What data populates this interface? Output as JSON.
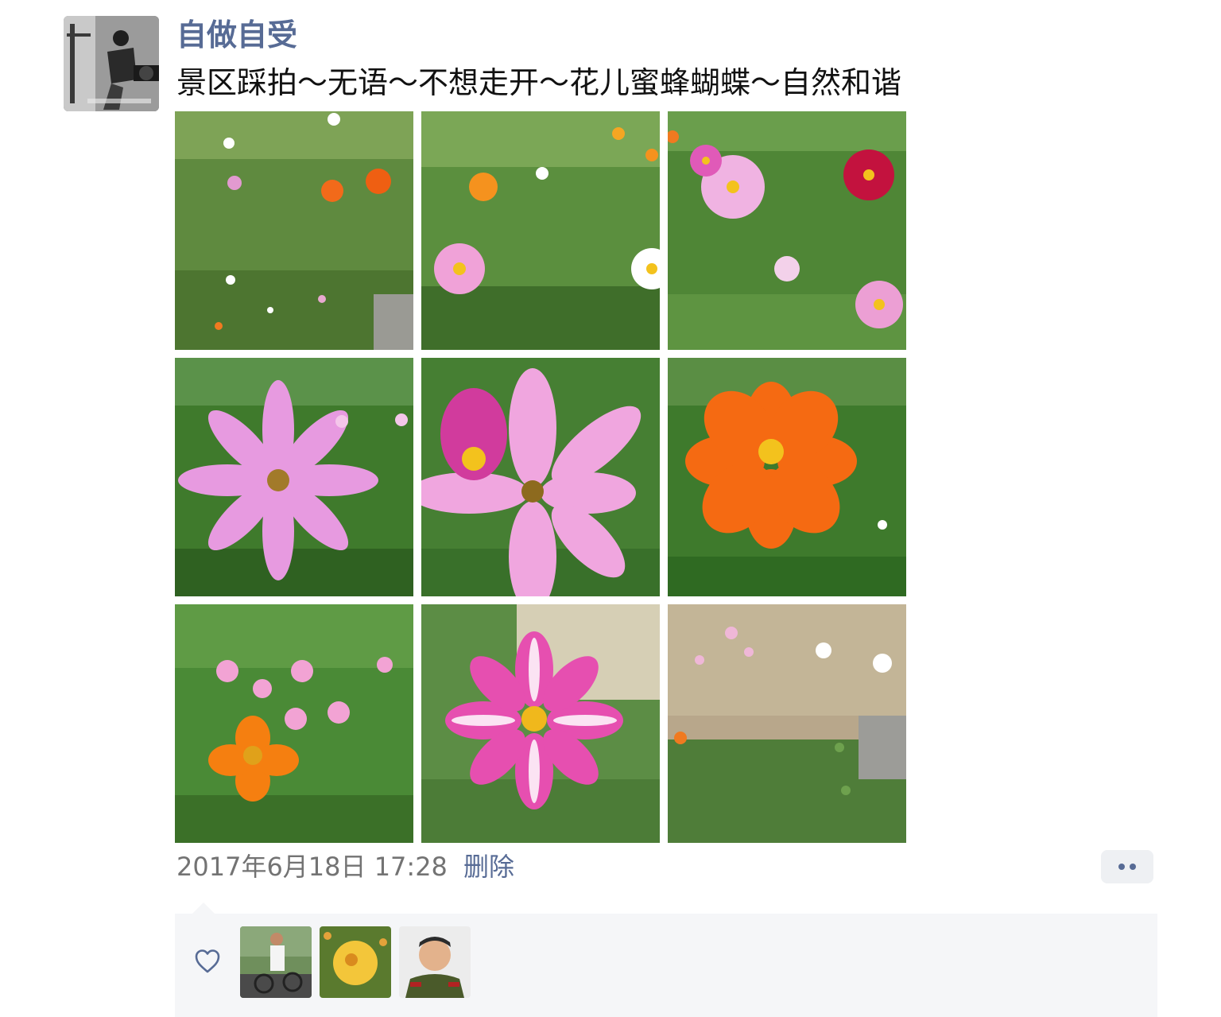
{
  "post": {
    "author_name": "自做自受",
    "text": "景区踩拍～无语～不想走开～花儿蜜蜂蝴蝶～自然和谐",
    "timestamp": "2017年6月18日 17:28",
    "delete_label": "删除",
    "photo_count": 9
  },
  "likes": {
    "icon": "heart-outline-icon",
    "liker_count": 3
  },
  "colors": {
    "link": "#576b95",
    "text": "#111111",
    "meta": "#737373",
    "panel": "#f5f6f8"
  }
}
